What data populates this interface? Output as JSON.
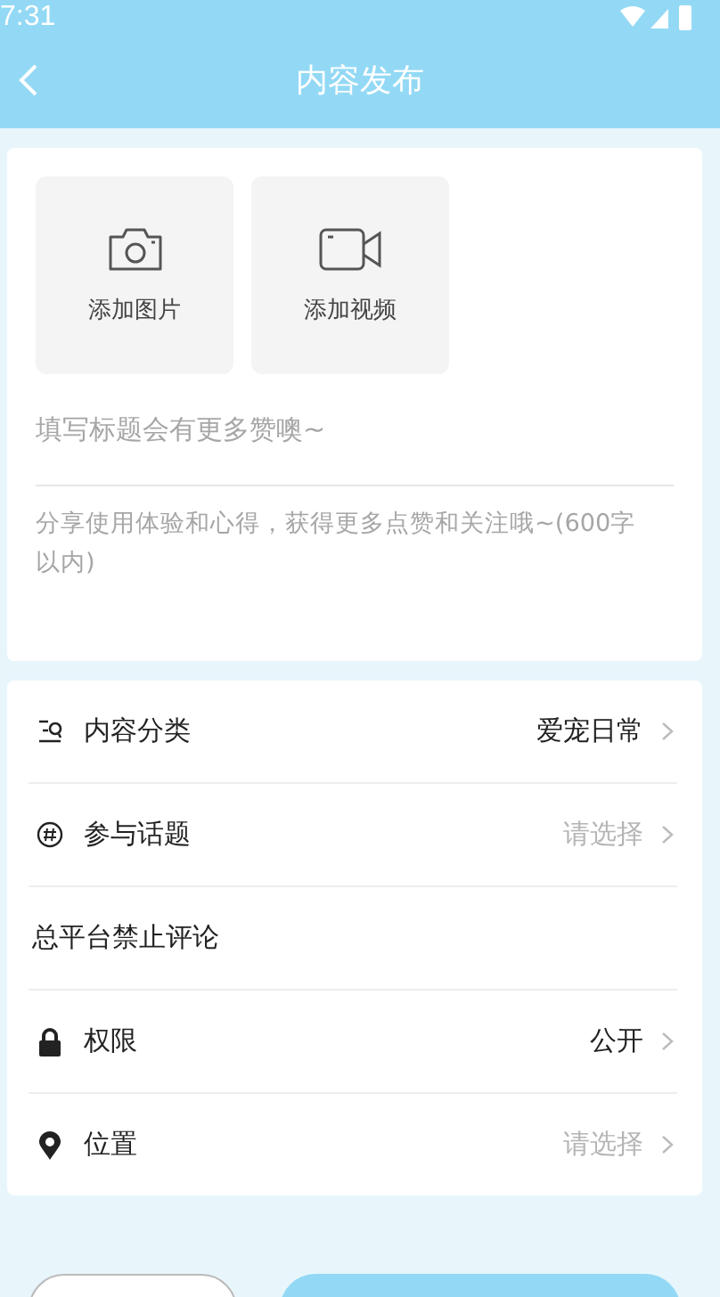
{
  "status_bar": {
    "time": "7:31"
  },
  "header": {
    "title": "内容发布"
  },
  "media_buttons": [
    {
      "kind": "photo",
      "label": "添加图片"
    },
    {
      "kind": "video",
      "label": "添加视频"
    }
  ],
  "title_field": {
    "placeholder": "填写标题会有更多赞噢~"
  },
  "body_field": {
    "placeholder": "分享使用体验和心得，获得更多点赞和关注哦~(600字以内)"
  },
  "settings": [
    {
      "kind": "category",
      "label": "内容分类",
      "value": "爱宠日常",
      "filled": true
    },
    {
      "kind": "topic",
      "label": "参与话题",
      "value": "请选择",
      "filled": false
    },
    {
      "kind": "text",
      "label": "总平台禁止评论"
    },
    {
      "kind": "lock",
      "label": "权限",
      "value": "公开",
      "filled": true
    },
    {
      "kind": "location",
      "label": "位置",
      "value": "请选择",
      "filled": false
    }
  ],
  "bottom_buttons": [
    {
      "kind": "secondary"
    },
    {
      "kind": "primary"
    }
  ]
}
